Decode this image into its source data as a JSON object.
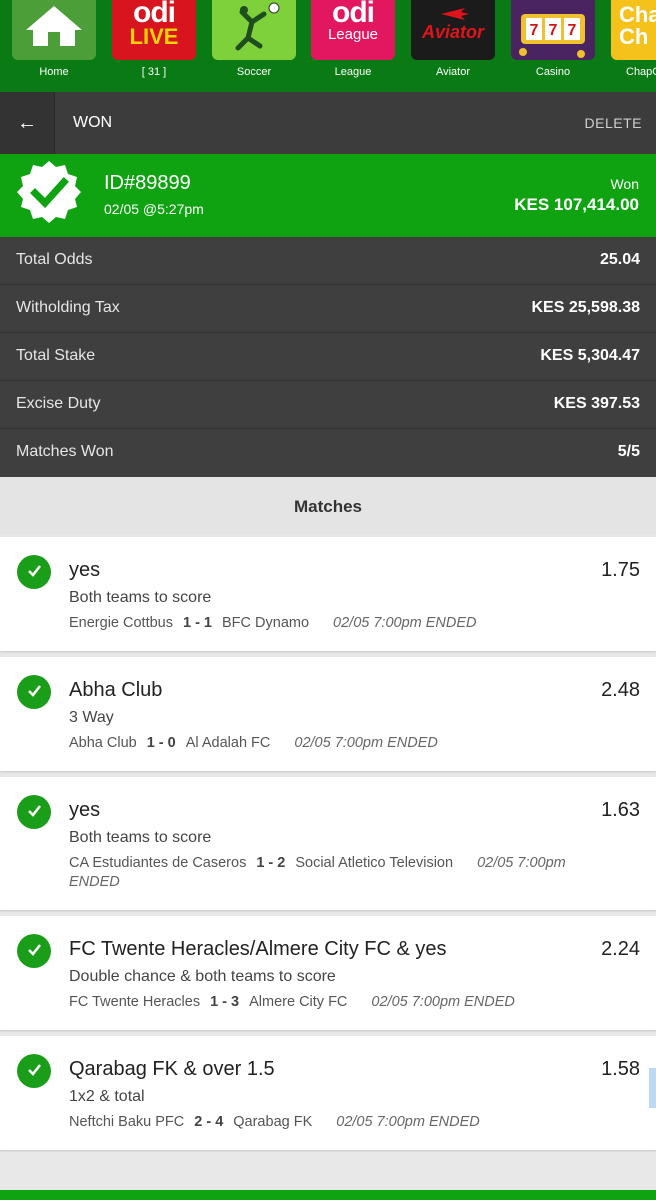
{
  "nav": [
    {
      "label": "Home",
      "icon": "home-icon"
    },
    {
      "label": "[ 31 ]",
      "tile_text": [
        "odi",
        "LIVE"
      ],
      "icon": "odi-live-logo"
    },
    {
      "label": "Soccer",
      "icon": "soccer-player-icon"
    },
    {
      "label": "League",
      "tile_text": [
        "odi",
        "League"
      ],
      "icon": "odi-league-logo"
    },
    {
      "label": "Aviator",
      "tile_text": [
        "Aviator"
      ],
      "icon": "aviator-logo"
    },
    {
      "label": "Casino",
      "icon": "slot-machine-icon"
    },
    {
      "label": "ChapC",
      "tile_text": [
        "Cha",
        "Ch"
      ],
      "icon": "chapchap-logo"
    }
  ],
  "header": {
    "back_icon": "←",
    "title": "WON",
    "delete_label": "DELETE"
  },
  "bet": {
    "id": "ID#89899",
    "date": "02/05 @5:27pm",
    "status": "Won",
    "amount": "KES 107,414.00"
  },
  "summary": [
    {
      "label": "Total Odds",
      "value": "25.04"
    },
    {
      "label": "Witholding Tax",
      "value": "KES 25,598.38"
    },
    {
      "label": "Total Stake",
      "value": "KES 5,304.47"
    },
    {
      "label": "Excise Duty",
      "value": "KES 397.53"
    },
    {
      "label": "Matches Won",
      "value": "5/5"
    }
  ],
  "matches_title": "Matches",
  "matches": [
    {
      "pick": "yes",
      "market": "Both teams to score",
      "odds": "1.75",
      "home": "Energie Cottbus",
      "score": "1 - 1",
      "away": "BFC Dynamo",
      "time": "02/05 7:00pm ENDED"
    },
    {
      "pick": "Abha Club",
      "market": "3 Way",
      "odds": "2.48",
      "home": "Abha Club",
      "score": "1 - 0",
      "away": "Al Adalah FC",
      "time": "02/05 7:00pm ENDED"
    },
    {
      "pick": "yes",
      "market": "Both teams to score",
      "odds": "1.63",
      "home": "CA Estudiantes de Caseros",
      "score": "1 - 2",
      "away": "Social Atletico Television",
      "time": "02/05 7:00pm ENDED"
    },
    {
      "pick": "FC Twente Heracles/Almere City FC & yes",
      "market": "Double chance & both teams to score",
      "odds": "2.24",
      "home": "FC Twente Heracles",
      "score": "1 - 3",
      "away": "Almere City FC",
      "time": "02/05 7:00pm ENDED"
    },
    {
      "pick": "Qarabag FK & over 1.5",
      "market": "1x2 & total",
      "odds": "1.58",
      "home": "Neftchi Baku PFC",
      "score": "2 - 4",
      "away": "Qarabag FK",
      "time": "02/05 7:00pm ENDED"
    }
  ],
  "colors": {
    "brand_green": "#0fa312",
    "nav_green": "#0a7a14",
    "dark_header": "#3c3c3c",
    "check_green": "#1a9e1a"
  }
}
